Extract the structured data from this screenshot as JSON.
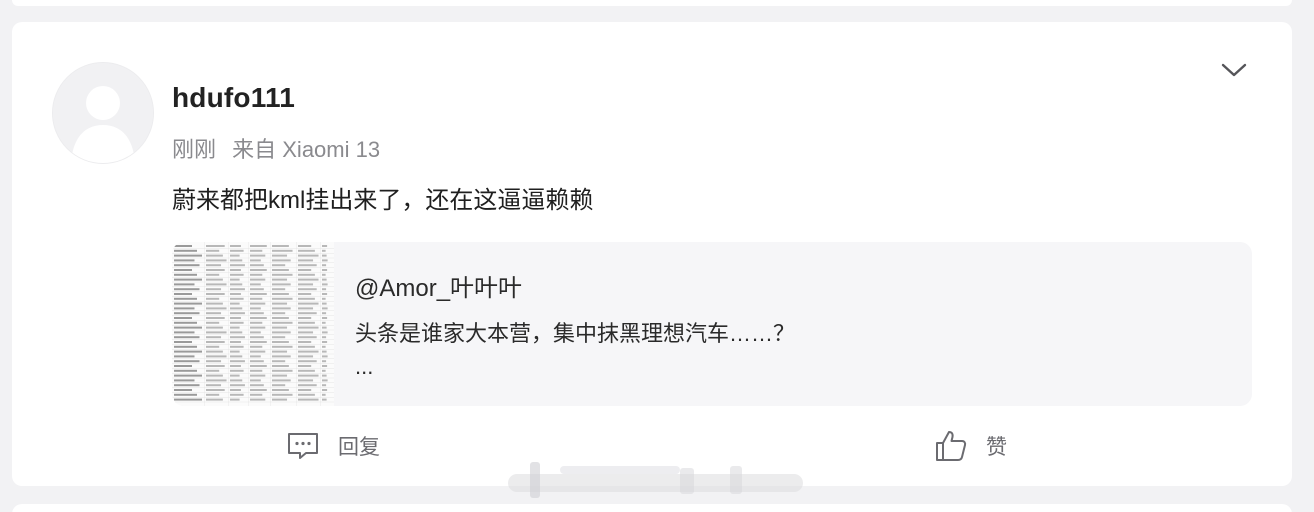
{
  "post": {
    "username": "hdufo111",
    "time": "刚刚",
    "source": "来自 Xiaomi 13",
    "text": "蔚来都把kml挂出来了，还在这逼逼赖赖"
  },
  "quote": {
    "user": "@Amor_叶叶叶",
    "text": "头条是谁家大本营，集中抹黑理想汽车……？",
    "more": "..."
  },
  "actions": {
    "reply_label": "回复",
    "like_label": "赞"
  },
  "icons": {
    "menu": "chevron-down-icon",
    "reply": "comment-icon",
    "like": "thumbs-up-icon",
    "avatar": "default-avatar-icon"
  },
  "colors": {
    "background": "#f2f2f4",
    "card": "#ffffff",
    "quote_bg": "#f6f6f8",
    "secondary_text": "#8a8a8e"
  }
}
